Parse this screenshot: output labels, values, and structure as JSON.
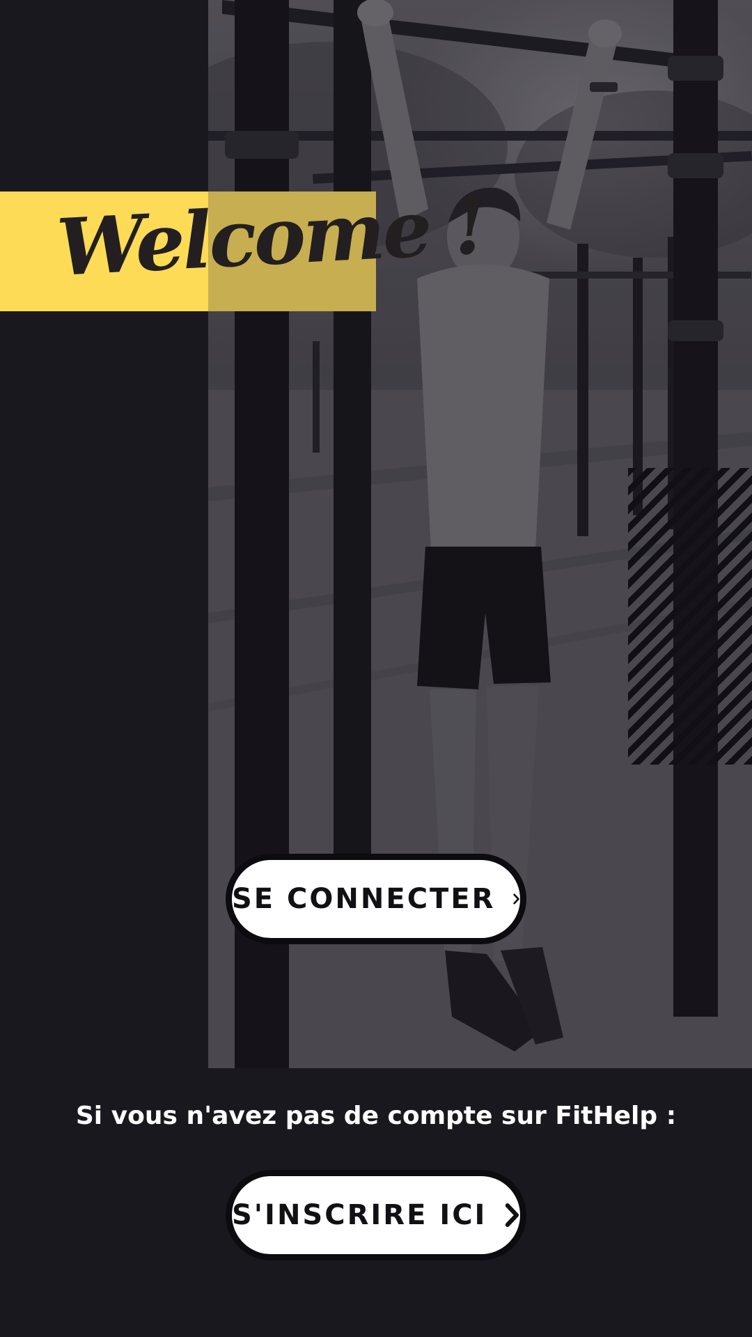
{
  "welcome": {
    "title": "Welcome !"
  },
  "login_button": {
    "label": "SE CONNECTER",
    "icon": "chevron-right-icon"
  },
  "signup": {
    "prompt": "Si vous n'avez pas de compte sur FitHelp :",
    "button_label": "S'INSCRIRE ICI",
    "icon": "chevron-right-icon"
  },
  "hero": {
    "image": "man-hanging-from-pull-up-bar-photo"
  },
  "colors": {
    "background": "#1a181f",
    "accent_yellow": "#fddb56",
    "button_bg": "#ffffff",
    "button_border": "#0c0b0f",
    "text_dark": "#231f20",
    "text_light": "#ffffff"
  }
}
